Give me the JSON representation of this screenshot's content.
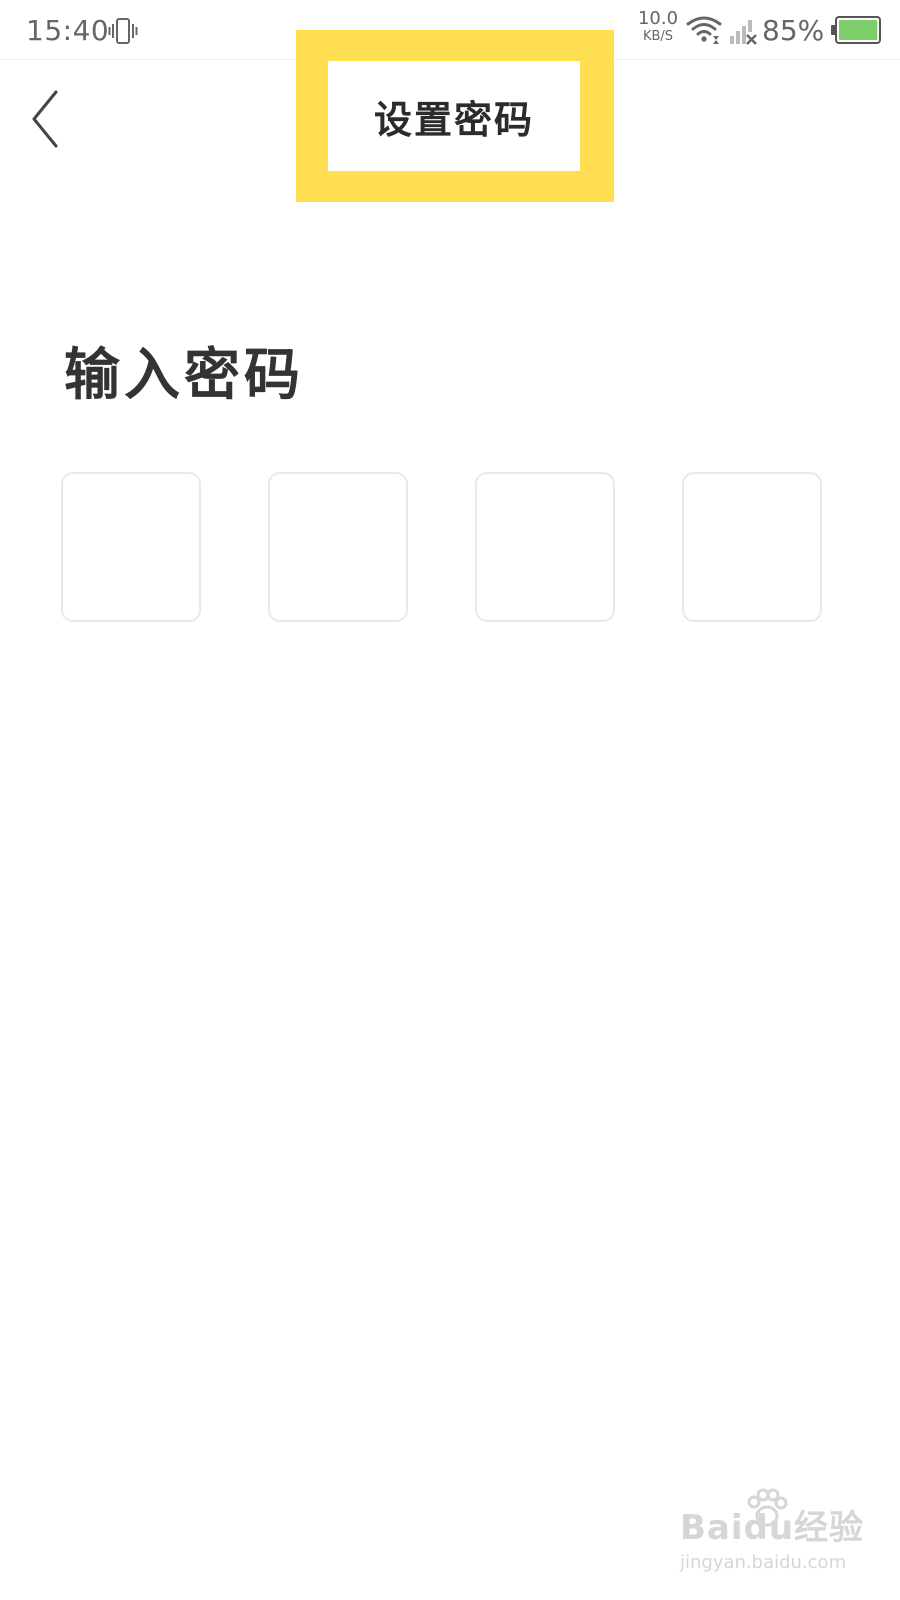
{
  "status_bar": {
    "time": "15:40",
    "net_speed_value": "10.0",
    "net_speed_unit": "KB/S",
    "battery_percent": "85%",
    "battery_level": 0.85,
    "icons": [
      "vibrate-icon",
      "wifi-icon",
      "signal-no-service-icon",
      "battery-icon"
    ]
  },
  "header": {
    "title": "设置密码",
    "back_icon": "chevron-left-icon"
  },
  "main": {
    "heading": "输入密码",
    "pin_boxes": [
      "",
      "",
      "",
      ""
    ]
  },
  "watermark": {
    "logo": "Baidu经验",
    "url": "jingyan.baidu.com"
  },
  "colors": {
    "highlight": "#ffdf4f",
    "battery_fill": "#7ccf6a",
    "pin_border": "#e9e9e9",
    "text_dark": "#333333",
    "status_text": "#666666"
  }
}
